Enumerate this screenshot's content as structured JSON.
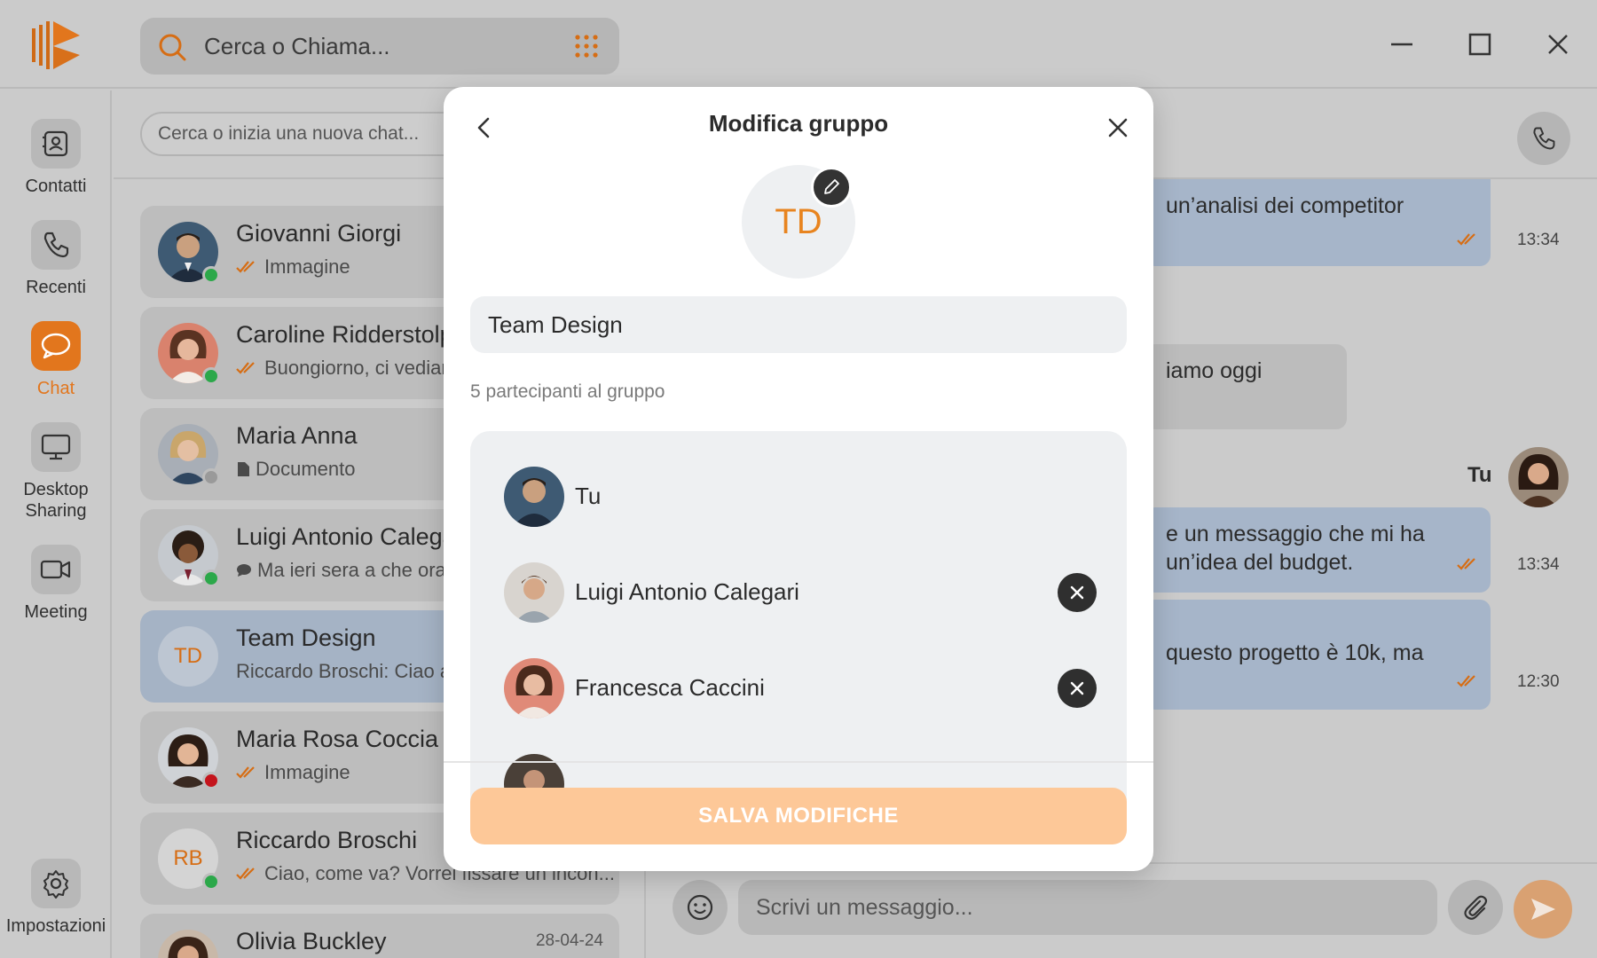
{
  "app": {
    "brand_color": "#e2761d",
    "search_placeholder": "Cerca o Chiama..."
  },
  "nav": {
    "items": [
      {
        "label": "Contatti",
        "icon": "contacts-icon"
      },
      {
        "label": "Recenti",
        "icon": "phone-icon"
      },
      {
        "label": "Chat",
        "icon": "chat-bubble-icon",
        "active": true
      },
      {
        "label": "Desktop Sharing",
        "icon": "monitor-icon"
      },
      {
        "label": "Meeting",
        "icon": "video-camera-icon"
      }
    ],
    "settings_label": "Impostazioni"
  },
  "chat_list": {
    "search_placeholder": "Cerca o inizia una nuova chat...",
    "items": [
      {
        "name": "Giovanni Giorgi",
        "preview": "Immagine",
        "status": "online"
      },
      {
        "name": "Caroline Ridderstolpe",
        "preview": "Buongiorno, ci vediamo",
        "status": "online"
      },
      {
        "name": "Maria Anna",
        "preview": "Documento",
        "status": "offline"
      },
      {
        "name": "Luigi Antonio Calegari",
        "preview": "Ma ieri sera a che ora",
        "status": "online"
      },
      {
        "name": "Team Design",
        "initials": "TD",
        "preview": "Riccardo Broschi: Ciao a",
        "selected": true
      },
      {
        "name": "Maria Rosa Coccia",
        "preview": "Immagine",
        "status": "busy"
      },
      {
        "name": "Riccardo Broschi",
        "initials": "RB",
        "preview": "Ciao, come va? Vorrei fissare un incon...",
        "status": "online"
      },
      {
        "name": "Olivia Buckley",
        "date": "28-04-24"
      }
    ]
  },
  "conversation": {
    "messages": [
      {
        "text": "un’analisi dei competitor",
        "time": "13:34"
      },
      {
        "text": "iamo oggi"
      },
      {
        "sender": "Tu"
      },
      {
        "text_line1": "e un messaggio che mi ha",
        "text_line2": "un’idea del budget.",
        "time": "13:34"
      },
      {
        "text": "questo progetto è 10k, ma",
        "time": "12:30"
      }
    ],
    "composer_placeholder": "Scrivi un messaggio..."
  },
  "modal": {
    "title": "Modifica gruppo",
    "group_initials": "TD",
    "group_name": "Team Design",
    "participants_count_label": "5 partecipanti al gruppo",
    "participants": [
      {
        "name": "Tu",
        "removable": false
      },
      {
        "name": "Luigi Antonio Calegari",
        "removable": true
      },
      {
        "name": "Francesca Caccini",
        "removable": true
      }
    ],
    "save_label": "SALVA MODIFICHE",
    "save_color": "#fdc898"
  }
}
